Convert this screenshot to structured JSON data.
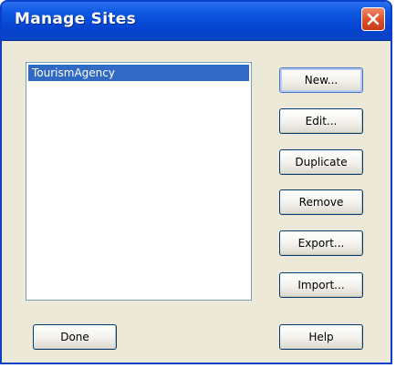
{
  "window": {
    "title": "Manage Sites"
  },
  "sites": {
    "items": [
      "TourismAgency"
    ],
    "selected_index": 0
  },
  "buttons": {
    "new": "New...",
    "edit": "Edit...",
    "duplicate": "Duplicate",
    "remove": "Remove",
    "export": "Export...",
    "import": "Import...",
    "done": "Done",
    "help": "Help"
  },
  "icons": {
    "close": "close-icon"
  },
  "colors": {
    "titlebar": "#0543cf",
    "dialog_bg": "#ece9d8",
    "selection": "#316ac5",
    "close_button": "#e0522a"
  }
}
